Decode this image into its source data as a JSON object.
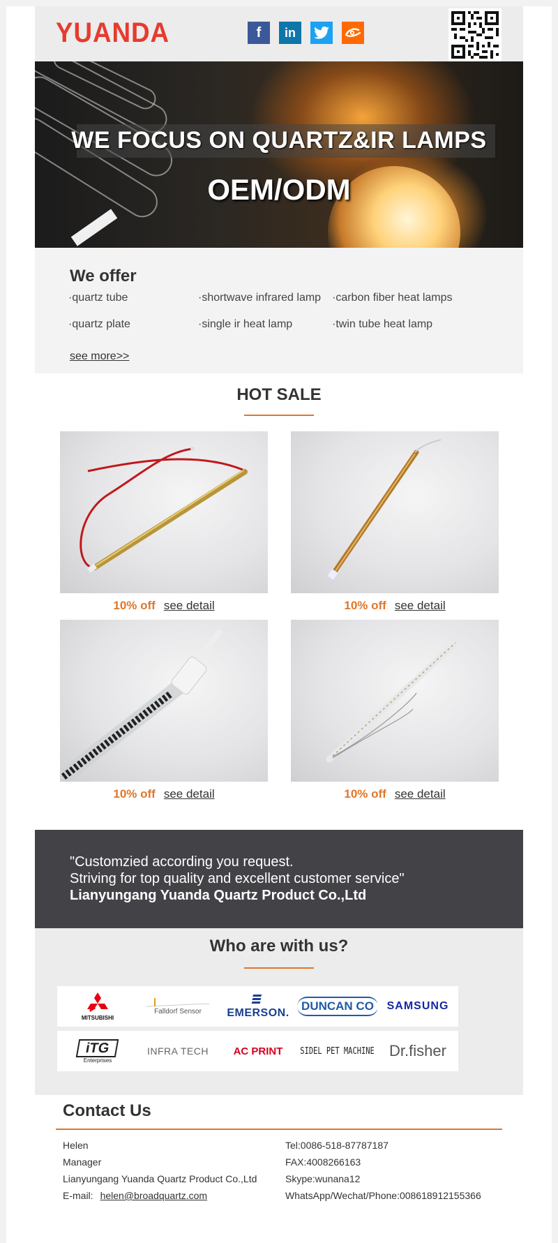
{
  "header": {
    "logo_text": "YUANDA",
    "social": [
      {
        "name": "facebook",
        "glyph": "f",
        "color": "#3b5998"
      },
      {
        "name": "linkedin",
        "glyph": "in",
        "color": "#0e76a8"
      },
      {
        "name": "twitter",
        "glyph": "t",
        "color": "#1da1f2"
      },
      {
        "name": "alibaba",
        "glyph": "a",
        "color": "#ff6a00"
      }
    ],
    "qr_icon": "qr-code-icon"
  },
  "banner": {
    "title": "WE FOCUS ON QUARTZ&IR LAMPS",
    "subtitle": "OEM/ODM"
  },
  "offer": {
    "title": "We offer",
    "items": [
      "·quartz tube",
      "·shortwave infrared lamp",
      "·carbon fiber heat lamps",
      "·quartz plate",
      "·single ir heat lamp",
      "·twin tube heat lamp"
    ],
    "see_more": "see more>>"
  },
  "hot_sale": {
    "title": "HOT SALE",
    "products": [
      {
        "discount": "10% off",
        "link": "see detail"
      },
      {
        "discount": "10% off",
        "link": "see detail"
      },
      {
        "discount": "10% off",
        "link": "see detail"
      },
      {
        "discount": "10% off",
        "link": "see detail"
      }
    ]
  },
  "quote": {
    "line1": "\"Customzied according you request.",
    "line2": "Striving for top quality and excellent customer service\"",
    "company": "Lianyungang Yuanda Quartz Product Co.,Ltd"
  },
  "partners": {
    "title": "Who are with us?",
    "logos": [
      "MITSUBISHI",
      "Falldorf Sensor",
      "EMERSON.",
      "DUNCAN CO",
      "SAMSUNG",
      "iTG",
      "INFRA TECH",
      "AC PRINT",
      "SIDEL PET MACHINE",
      "Dr.fisher"
    ],
    "itg_sub": "Enterprises"
  },
  "contact": {
    "title": "Contact Us",
    "name": "Helen",
    "role": "Manager",
    "company": "Lianyungang Yuanda Quartz Product Co.,Ltd",
    "email_label": "E-mail:",
    "email": "helen@broadquartz.com",
    "tel": "Tel:0086-518-87787187",
    "fax": "FAX:4008266163",
    "skype": "Skype:wunana12",
    "whatsapp": "WhatsApp/Wechat/Phone:008618912155366"
  },
  "colors": {
    "brand_red": "#e63b2e",
    "accent_orange": "#e0762a",
    "dark_band": "#434347"
  }
}
